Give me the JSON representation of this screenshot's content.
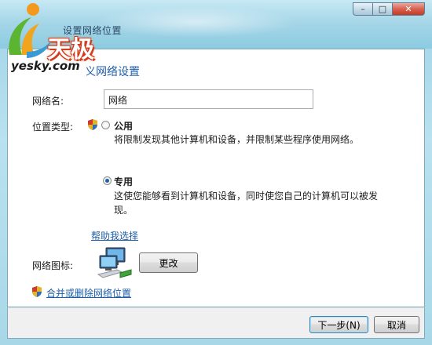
{
  "window": {
    "title": "设置网络位置",
    "controls": {
      "minimize": "–",
      "maximize": "□",
      "close": "✕"
    }
  },
  "logo": {
    "brand": "天极",
    "site": "yesky.com"
  },
  "header": {
    "heading": "自定义网络设置"
  },
  "form": {
    "network_name_label": "网络名:",
    "network_name_value": "网络",
    "location_type_label": "位置类型:",
    "public": {
      "label": "公用",
      "description": "将限制发现其他计算机和设备，并限制某些程序使用网络。",
      "selected": false
    },
    "private": {
      "label": "专用",
      "description_line1": "这使您能够看到计算机和设备，同时使您自己的计算机可以被发",
      "description_line2": "现。",
      "selected": true
    },
    "help_link": "帮助我选择",
    "network_icon_label": "网络图标:",
    "change_button": "更改",
    "merge_link": "合并或删除网络位置"
  },
  "footer": {
    "next_button": "下一步(N)",
    "cancel_button": "取消"
  },
  "colors": {
    "link": "#1d5ea8",
    "aero": "#9fd3e6",
    "logo_accent": "#d23b1e"
  }
}
